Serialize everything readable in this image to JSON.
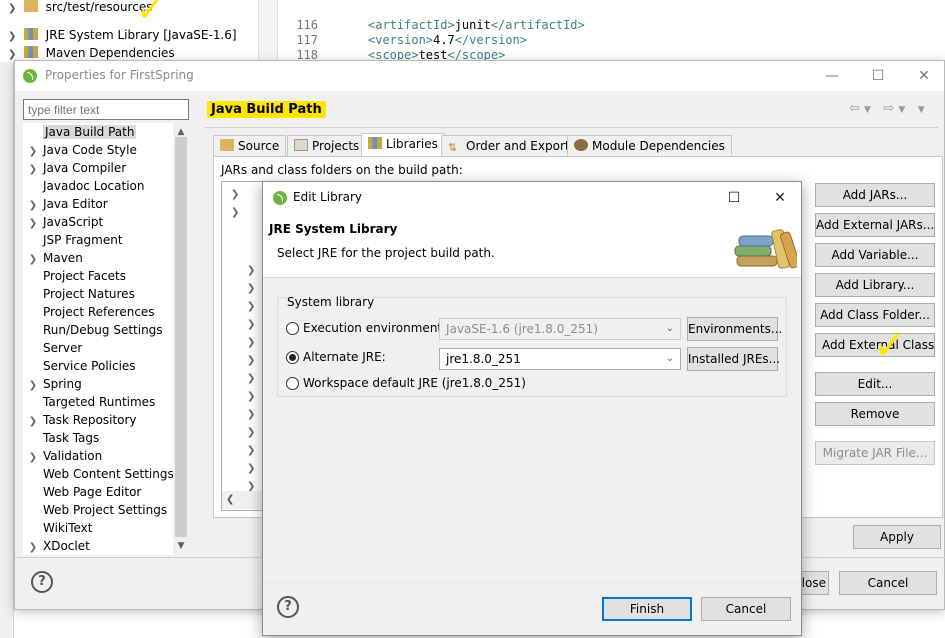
{
  "explorer": {
    "items": [
      {
        "label": "src/test/resources",
        "expanded": false
      },
      {
        "label": "JRE System Library [JavaSE-1.6]",
        "expanded": false
      },
      {
        "label": "Maven Dependencies",
        "expanded": true
      }
    ]
  },
  "editor": {
    "lines": [
      {
        "num": "116",
        "open": "<artifactId>",
        "value": "junit",
        "close": "</artifactId>"
      },
      {
        "num": "117",
        "open": "<version>",
        "value": "4.7",
        "close": "</version>"
      },
      {
        "num": "118",
        "open": "<scope>",
        "value": "test",
        "close": "</scope>"
      }
    ]
  },
  "properties_dialog": {
    "title": "Properties for FirstSpring",
    "filter_placeholder": "type filter text",
    "heading": "Java Build Path",
    "nav_items": [
      {
        "label": "Java Build Path",
        "arrow": false,
        "selected": true
      },
      {
        "label": "Java Code Style",
        "arrow": true
      },
      {
        "label": "Java Compiler",
        "arrow": true
      },
      {
        "label": "Javadoc Location",
        "arrow": false
      },
      {
        "label": "Java Editor",
        "arrow": true
      },
      {
        "label": "JavaScript",
        "arrow": true
      },
      {
        "label": "JSP Fragment",
        "arrow": false
      },
      {
        "label": "Maven",
        "arrow": true
      },
      {
        "label": "Project Facets",
        "arrow": false
      },
      {
        "label": "Project Natures",
        "arrow": false
      },
      {
        "label": "Project References",
        "arrow": false
      },
      {
        "label": "Run/Debug Settings",
        "arrow": false
      },
      {
        "label": "Server",
        "arrow": false
      },
      {
        "label": "Service Policies",
        "arrow": false
      },
      {
        "label": "Spring",
        "arrow": true
      },
      {
        "label": "Targeted Runtimes",
        "arrow": false
      },
      {
        "label": "Task Repository",
        "arrow": true
      },
      {
        "label": "Task Tags",
        "arrow": false
      },
      {
        "label": "Validation",
        "arrow": true
      },
      {
        "label": "Web Content Settings",
        "arrow": false
      },
      {
        "label": "Web Page Editor",
        "arrow": false
      },
      {
        "label": "Web Project Settings",
        "arrow": false
      },
      {
        "label": "WikiText",
        "arrow": false
      },
      {
        "label": "XDoclet",
        "arrow": true
      }
    ],
    "tabs": [
      {
        "label": "Source",
        "active": false
      },
      {
        "label": "Projects",
        "active": false
      },
      {
        "label": "Libraries",
        "active": true
      },
      {
        "label": "Order and Export",
        "active": false
      },
      {
        "label": "Module Dependencies",
        "active": false
      }
    ],
    "jars_label": "JARs and class folders on the build path:",
    "side_buttons": [
      {
        "label": "Add JARs...",
        "enabled": true
      },
      {
        "label": "Add External JARs...",
        "enabled": true
      },
      {
        "label": "Add Variable...",
        "enabled": true
      },
      {
        "label": "Add Library...",
        "enabled": true
      },
      {
        "label": "Add Class Folder...",
        "enabled": true
      },
      {
        "label": "Add External Class Folder...",
        "enabled": true
      },
      {
        "label": "Edit...",
        "enabled": true
      },
      {
        "label": "Remove",
        "enabled": true
      },
      {
        "label": "Migrate JAR File...",
        "enabled": false
      }
    ],
    "apply_label": "Apply",
    "close_label": "Close",
    "cancel_label": "Cancel"
  },
  "edit_library_dialog": {
    "title": "Edit Library",
    "heading": "JRE System Library",
    "description": "Select JRE for the project build path.",
    "group_label": "System library",
    "options": {
      "execution_env": {
        "label": "Execution environment:",
        "value": "JavaSE-1.6 (jre1.8.0_251)",
        "selected": false,
        "button": "Environments..."
      },
      "alternate_jre": {
        "label": "Alternate JRE:",
        "value": "jre1.8.0_251",
        "selected": true,
        "button": "Installed JREs..."
      },
      "workspace_default": {
        "label": "Workspace default JRE (jre1.8.0_251)",
        "selected": false
      }
    },
    "finish_label": "Finish",
    "cancel_label": "Cancel"
  },
  "colors": {
    "highlight": "#ffe600",
    "xml_tag": "#3f7f7f",
    "focus_blue": "#0078d7"
  }
}
